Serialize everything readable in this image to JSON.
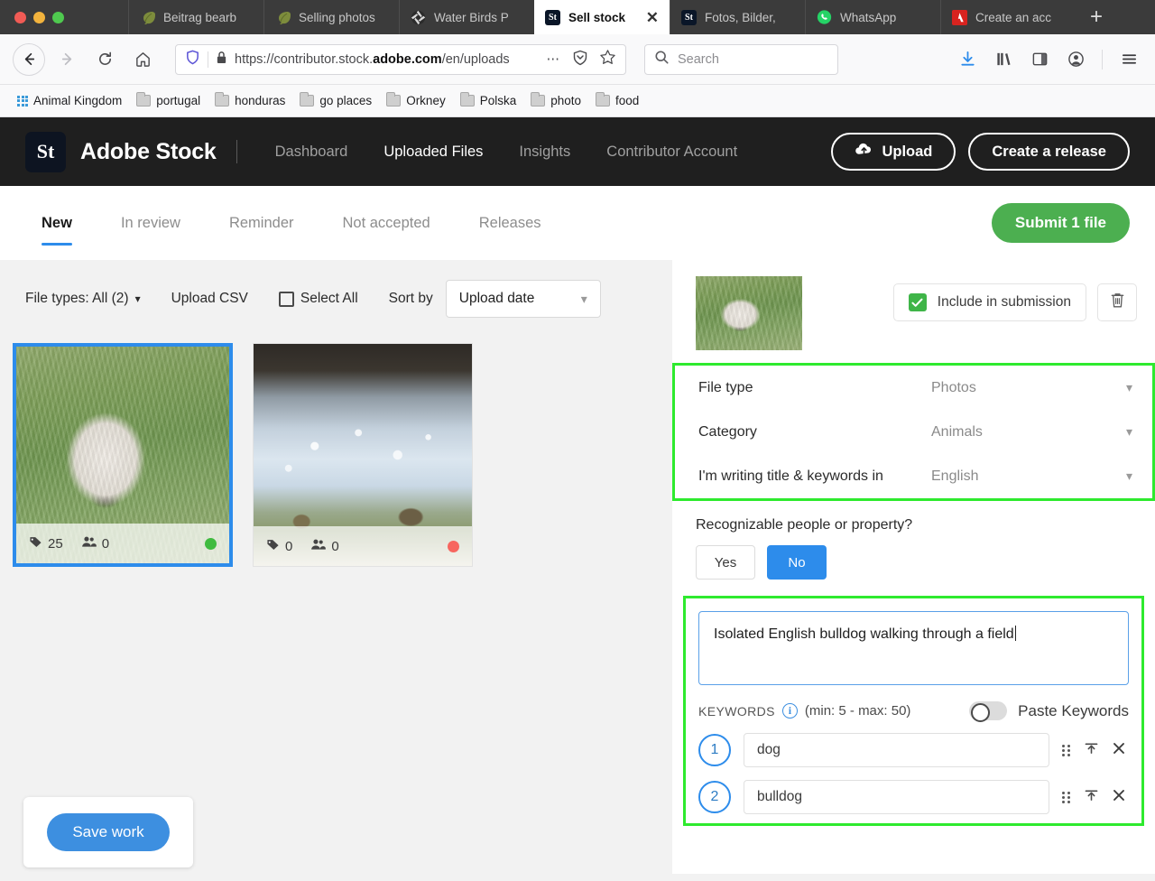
{
  "browser": {
    "tabs": [
      {
        "title": "Beitrag bearb",
        "icon": "leaf-icon",
        "active": false
      },
      {
        "title": "Selling photos",
        "icon": "leaf-icon",
        "active": false
      },
      {
        "title": "Water Birds P",
        "icon": "aperture-icon",
        "active": false
      },
      {
        "title": "Sell stock",
        "icon": "adobe-stock-icon",
        "active": true
      },
      {
        "title": "Fotos, Bilder,",
        "icon": "adobe-stock-icon",
        "active": false
      },
      {
        "title": "WhatsApp",
        "icon": "whatsapp-icon",
        "active": false
      },
      {
        "title": "Create an acc",
        "icon": "adobe-icon",
        "active": false
      }
    ],
    "new_tab_label": "+",
    "url": "https://contributor.stock.",
    "url_bold": "adobe.com",
    "url_rest": "/en/uploads",
    "search_placeholder": "Search",
    "bookmarks": [
      {
        "label": "Animal Kingdom",
        "icon": "apps-grid-icon"
      },
      {
        "label": "portugal",
        "icon": "folder-icon"
      },
      {
        "label": "honduras",
        "icon": "folder-icon"
      },
      {
        "label": "go places",
        "icon": "folder-icon"
      },
      {
        "label": "Orkney",
        "icon": "folder-icon"
      },
      {
        "label": "Polska",
        "icon": "folder-icon"
      },
      {
        "label": "photo",
        "icon": "folder-icon"
      },
      {
        "label": "food",
        "icon": "folder-icon"
      }
    ]
  },
  "header": {
    "logo_text": "St",
    "brand": "Adobe Stock",
    "nav": [
      {
        "label": "Dashboard",
        "active": false
      },
      {
        "label": "Uploaded Files",
        "active": true
      },
      {
        "label": "Insights",
        "active": false
      },
      {
        "label": "Contributor Account",
        "active": false
      }
    ],
    "upload_label": "Upload",
    "release_label": "Create a release"
  },
  "subtabs": {
    "items": [
      {
        "label": "New",
        "active": true
      },
      {
        "label": "In review",
        "active": false
      },
      {
        "label": "Reminder",
        "active": false
      },
      {
        "label": "Not accepted",
        "active": false
      },
      {
        "label": "Releases",
        "active": false
      }
    ],
    "submit_label": "Submit 1 file",
    "submit_color": "#4caf50"
  },
  "toolbar": {
    "file_types_label": "File types: All (2)",
    "upload_csv_label": "Upload CSV",
    "select_all_label": "Select All",
    "sort_by_label": "Sort by",
    "sort_value": "Upload date"
  },
  "files": [
    {
      "name": "english-bulldog-in-field",
      "keywords_count": "25",
      "people_count": "0",
      "status": "green",
      "selected": true
    },
    {
      "name": "water-birds-at-stream",
      "keywords_count": "0",
      "people_count": "0",
      "status": "red",
      "selected": false
    }
  ],
  "save": {
    "label": "Save work"
  },
  "details": {
    "include_label": "Include in submission",
    "include_checked": true,
    "delete_label": "Delete",
    "fields": [
      {
        "label": "File type",
        "value": "Photos"
      },
      {
        "label": "Category",
        "value": "Animals"
      },
      {
        "label": "I'm writing title & keywords in",
        "value": "English"
      }
    ],
    "recognizable_question": "Recognizable people or property?",
    "yes_label": "Yes",
    "no_label": "No",
    "recognizable_answer": "No",
    "title_value": "Isolated English bulldog walking through a field",
    "keywords_label": "KEYWORDS",
    "keywords_minmax": "(min: 5 - max: 50)",
    "paste_keywords_label": "Paste Keywords",
    "paste_keywords_on": false,
    "keywords": [
      {
        "index": "1",
        "value": "dog"
      },
      {
        "index": "2",
        "value": "bulldog"
      }
    ],
    "highlight_color": "#2eea2e"
  }
}
